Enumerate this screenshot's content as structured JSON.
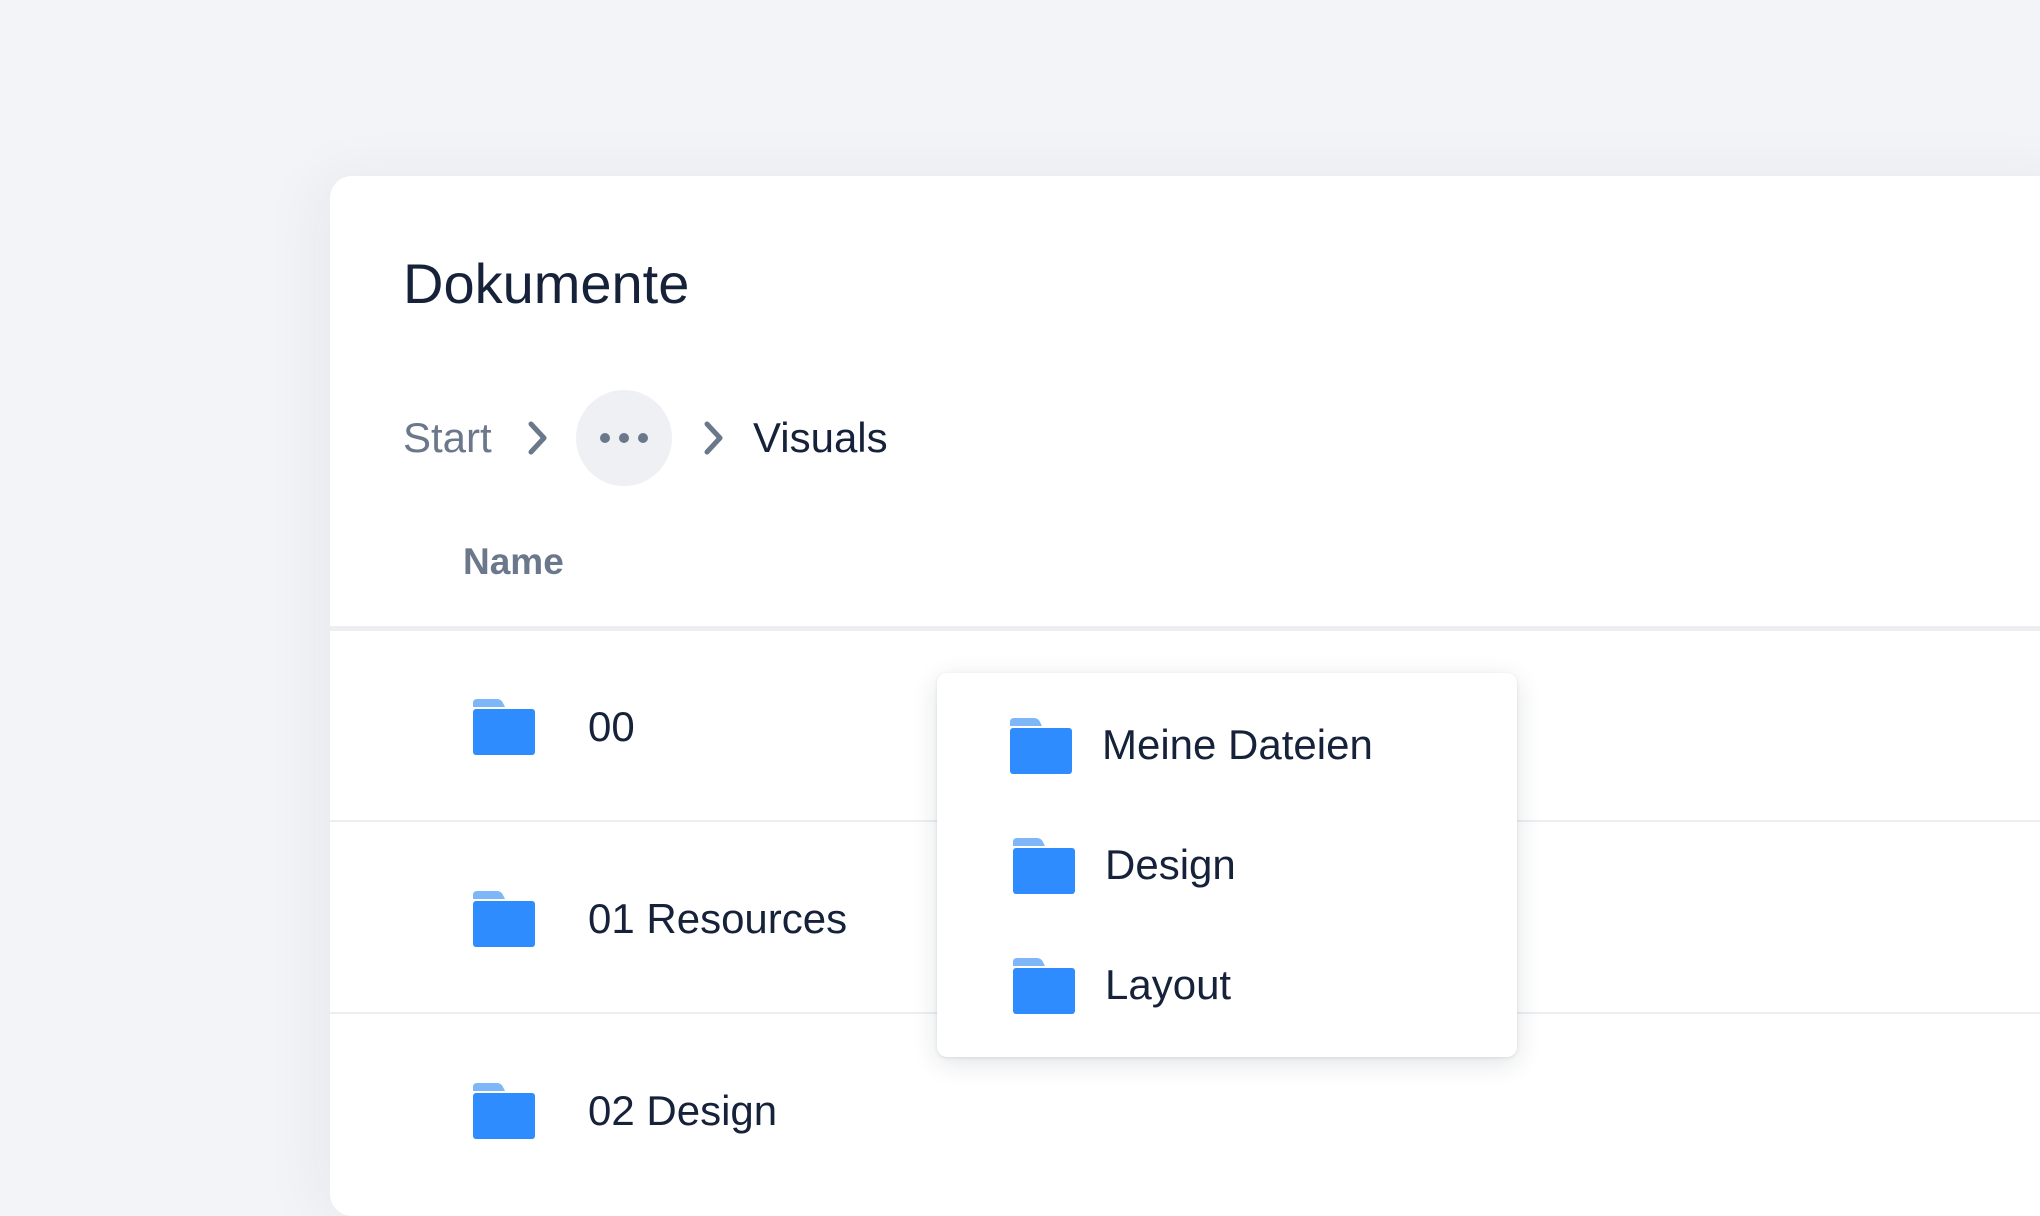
{
  "page": {
    "title": "Dokumente"
  },
  "breadcrumb": {
    "items": [
      {
        "label": "Start"
      },
      {
        "label": "Visuals"
      }
    ],
    "overflow_icon": "ellipsis-icon",
    "separator_icon": "chevron-right-icon"
  },
  "table": {
    "column_header": "Name",
    "rows": [
      {
        "name": "00",
        "icon": "folder-icon"
      },
      {
        "name": "01 Resources",
        "icon": "folder-icon"
      },
      {
        "name": "02 Design",
        "icon": "folder-icon"
      }
    ]
  },
  "dropdown": {
    "items": [
      {
        "label": "Meine Dateien",
        "icon": "folder-icon"
      },
      {
        "label": "Design",
        "icon": "folder-icon"
      },
      {
        "label": "Layout",
        "icon": "folder-icon"
      }
    ]
  },
  "colors": {
    "background": "#f2f4f7",
    "card": "#ffffff",
    "text_primary": "#16223a",
    "text_secondary": "#6b778b",
    "folder_front": "#2f8cff",
    "folder_back": "#7fb6f7",
    "divider": "#eceef2"
  }
}
